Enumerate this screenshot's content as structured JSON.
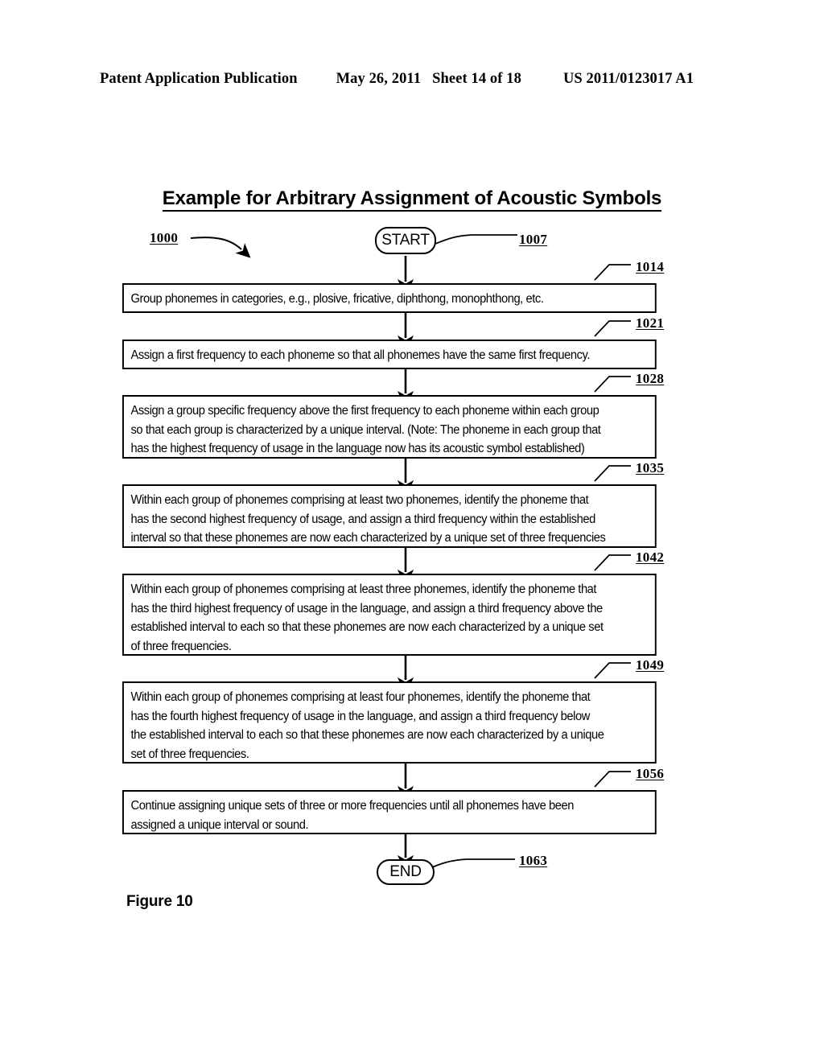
{
  "header": {
    "publication": "Patent Application Publication",
    "date": "May 26, 2011",
    "sheet": "Sheet 14 of 18",
    "patent_number": "US 2011/0123017 A1"
  },
  "figure": {
    "title": "Example for Arbitrary Assignment of Acoustic Symbols",
    "caption": "Figure 10",
    "diagram_ref": "1000"
  },
  "nodes": {
    "start": {
      "label": "START",
      "ref": "1007"
    },
    "end": {
      "label": "END",
      "ref": "1063"
    }
  },
  "steps": [
    {
      "ref": "1014",
      "lines": [
        "Group phonemes in categories, e.g., plosive, fricative, diphthong, monophthong, etc."
      ]
    },
    {
      "ref": "1021",
      "lines": [
        "Assign a first frequency to each phoneme so that all phonemes have the same first frequency."
      ]
    },
    {
      "ref": "1028",
      "lines": [
        "Assign a group specific frequency above the first frequency to each phoneme within each group",
        "so that each group is characterized by a unique interval.  (Note: The phoneme in each group that",
        "has the highest frequency of usage in the language now has its acoustic symbol established)"
      ]
    },
    {
      "ref": "1035",
      "lines": [
        "Within each group of phonemes comprising at least two phonemes, identify the phoneme that",
        "has the second highest frequency of usage, and assign a third frequency within the established",
        "interval so that these phonemes are now each characterized by a unique set of three frequencies"
      ]
    },
    {
      "ref": "1042",
      "lines": [
        "Within each group of phonemes comprising at least three phonemes, identify the phoneme that",
        "has the third highest frequency of usage in the language, and assign a third frequency above the",
        "established interval to each so that these phonemes are now each characterized by a unique set",
        "of three frequencies."
      ]
    },
    {
      "ref": "1049",
      "lines": [
        "Within each group of phonemes comprising at least four phonemes, identify the phoneme that",
        "has the fourth highest frequency of usage in the language, and assign a third frequency below",
        "the established interval to each so that these phonemes are now each characterized by a unique",
        "set of three frequencies."
      ]
    },
    {
      "ref": "1056",
      "lines": [
        "Continue assigning unique sets of three or more frequencies until all phonemes have been",
        "assigned a unique interval or sound."
      ]
    }
  ],
  "colors": {
    "ink": "#000000",
    "paper": "#ffffff"
  }
}
